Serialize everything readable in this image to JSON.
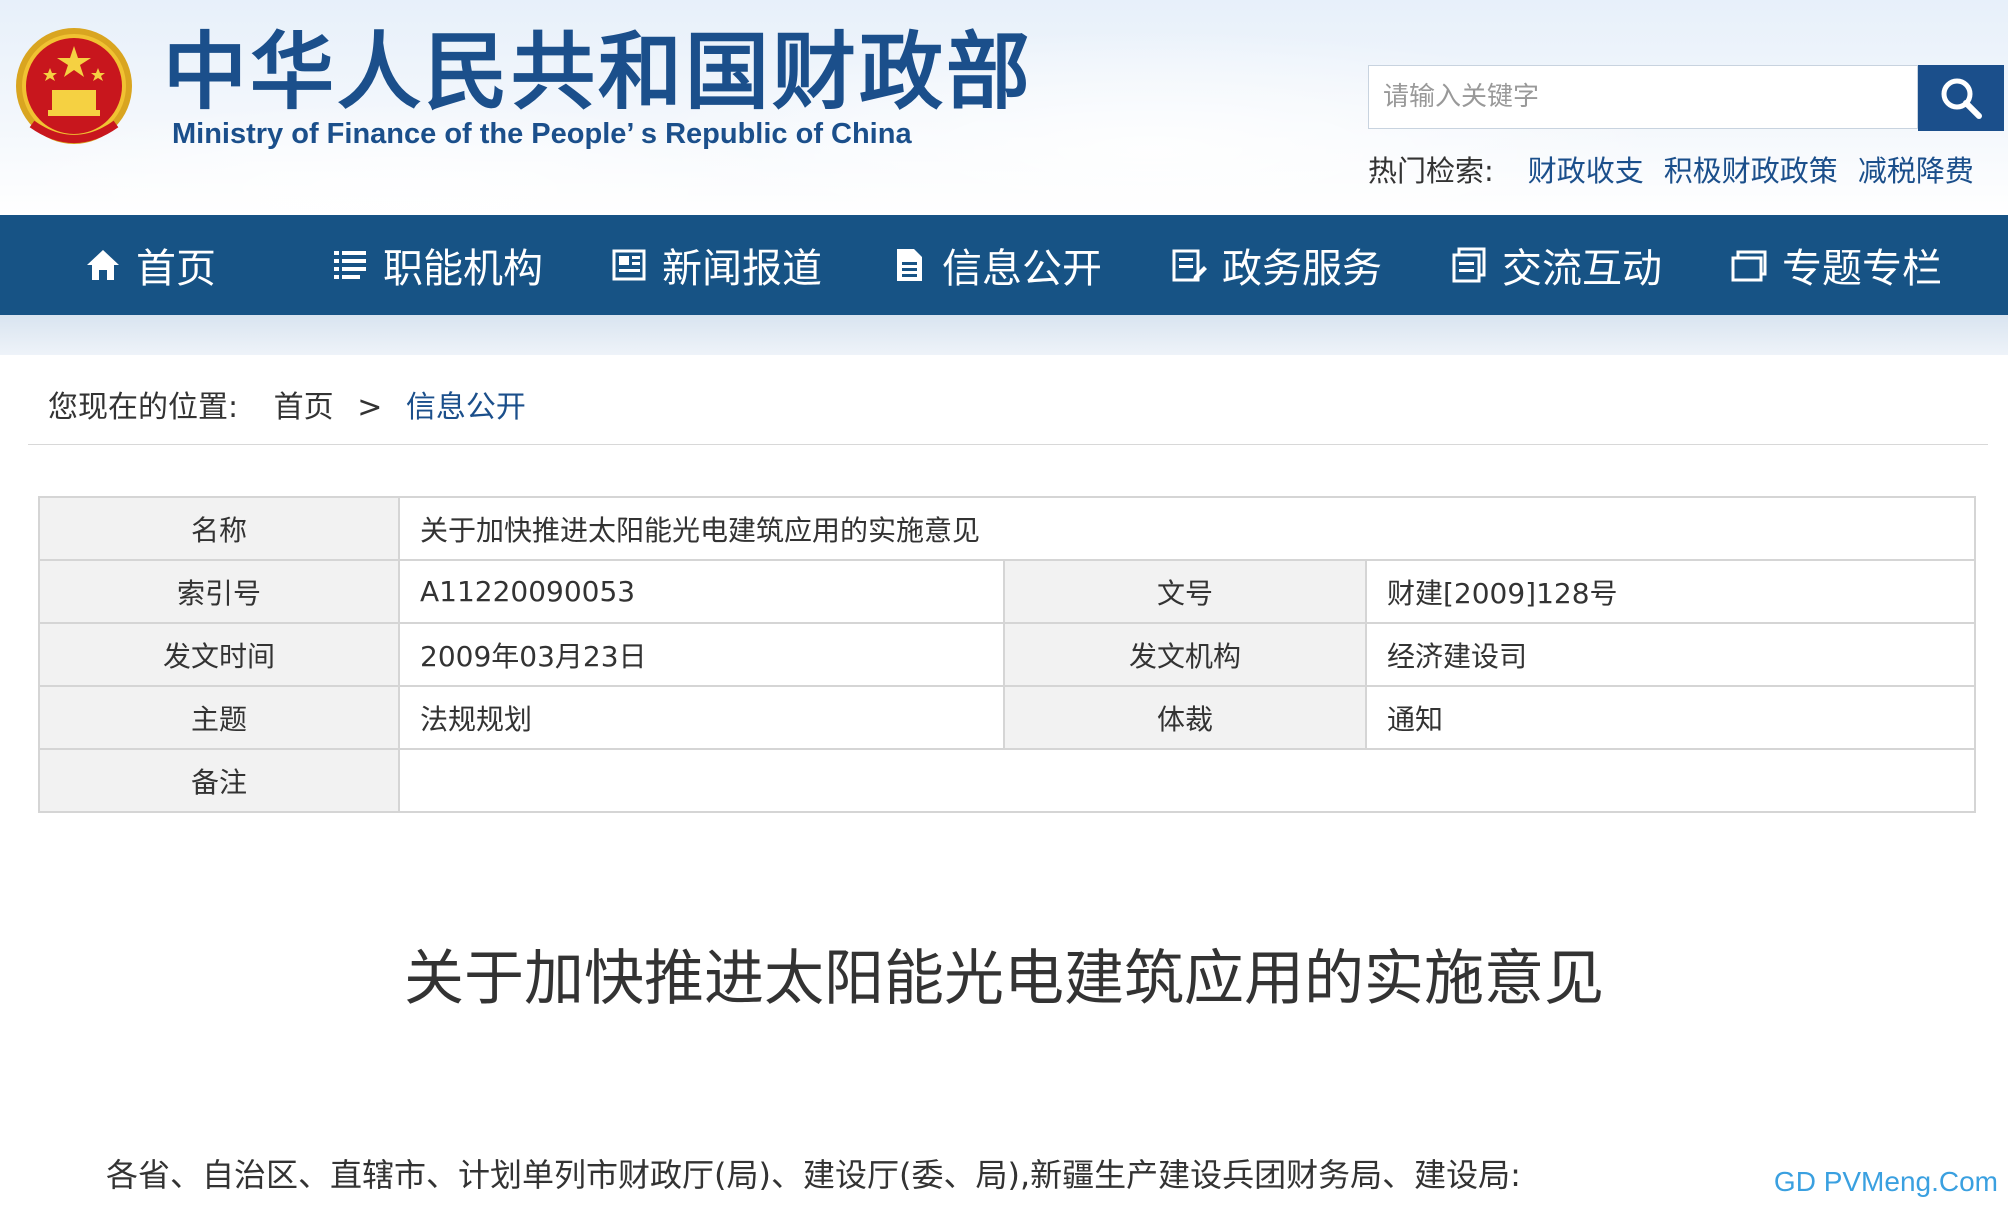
{
  "header": {
    "title_cn": "中华人民共和国财政部",
    "title_en": "Ministry of Finance of the People’ s Republic of China",
    "emblem_icon": "national-emblem-icon",
    "search": {
      "placeholder": "请输入关键字",
      "button_icon": "search-icon"
    },
    "hot_search": {
      "label": "热门检索:",
      "links": [
        "财政收支",
        "积极财政政策",
        "减税降费"
      ]
    }
  },
  "nav": {
    "items": [
      {
        "label": "首页",
        "icon": "home-icon"
      },
      {
        "label": "职能机构",
        "icon": "list-icon"
      },
      {
        "label": "新闻报道",
        "icon": "newspaper-icon"
      },
      {
        "label": "信息公开",
        "icon": "document-icon"
      },
      {
        "label": "政务服务",
        "icon": "clipboard-edit-icon"
      },
      {
        "label": "交流互动",
        "icon": "chat-document-icon"
      },
      {
        "label": "专题专栏",
        "icon": "window-icon"
      }
    ]
  },
  "breadcrumb": {
    "prefix": "您现在的位置:",
    "home": "首页",
    "separator": ">",
    "current": "信息公开"
  },
  "meta": {
    "name_label": "名称",
    "name_value": "关于加快推进太阳能光电建筑应用的实施意见",
    "index_label": "索引号",
    "index_value": "A11220090053",
    "docno_label": "文号",
    "docno_value": "财建[2009]128号",
    "date_label": "发文时间",
    "date_value": "2009年03月23日",
    "issuer_label": "发文机构",
    "issuer_value": "经济建设司",
    "topic_label": "主题",
    "topic_value": "法规规划",
    "genre_label": "体裁",
    "genre_value": "通知",
    "remark_label": "备注",
    "remark_value": ""
  },
  "document": {
    "title": "关于加快推进太阳能光电建筑应用的实施意见",
    "salutation": "各省、自治区、直辖市、计划单列市财政厅(局)、建设厅(委、局),新疆生产建设兵团财务局、建设局:"
  },
  "watermark": "GD PVMeng.Com",
  "colors": {
    "brand_blue": "#1b4f8b",
    "nav_bg": "#175385",
    "watermark": "#3aa0e0"
  }
}
